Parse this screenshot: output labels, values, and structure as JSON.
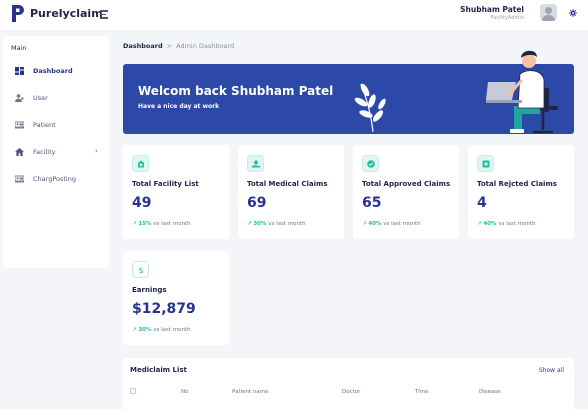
{
  "app": {
    "name": "Purelyclaim"
  },
  "user": {
    "name": "Shubham Patel",
    "role": "FacilityAdmin"
  },
  "sidebar": {
    "section": "Main",
    "items": [
      {
        "label": "Dashboard",
        "icon": "dashboard-icon",
        "active": true
      },
      {
        "label": "User",
        "icon": "user-icon"
      },
      {
        "label": "Patient",
        "icon": "patient-icon"
      },
      {
        "label": "Facility",
        "icon": "home-icon",
        "has_children": true
      },
      {
        "label": "ChargPosting",
        "icon": "charge-posting-icon"
      }
    ]
  },
  "breadcrumb": {
    "root": "Dashboard",
    "separator": ">",
    "current": "Admin Dashboard"
  },
  "banner": {
    "title": "Welcom back Shubham Patel",
    "subtitle": "Have a nice day at work"
  },
  "stats": [
    {
      "title": "Total Facility List",
      "value": "49",
      "delta": "15%",
      "delta_text": "vs last month",
      "icon": "hospital-icon"
    },
    {
      "title": "Total Medical Claims",
      "value": "69",
      "delta": "30%",
      "delta_text": "vs last month",
      "icon": "medical-hand-icon"
    },
    {
      "title": "Total Approved Claims",
      "value": "65",
      "delta": "40%",
      "delta_text": "vs last month",
      "icon": "check-circle-icon"
    },
    {
      "title": "Total Rejcted Claims",
      "value": "4",
      "delta": "40%",
      "delta_text": "vs last month",
      "icon": "rejected-box-icon"
    },
    {
      "title": "Earnings",
      "value": "$12,879",
      "delta": "30%",
      "delta_text": "vs last month",
      "icon": "dollar-icon"
    }
  ],
  "mediclaim": {
    "title": "Mediclaim List",
    "show_all": "Show all",
    "columns": [
      "No",
      "Patient name",
      "Doctor",
      "Time",
      "Disease"
    ]
  },
  "colors": {
    "primary": "#28338f",
    "banner": "#2c49a8",
    "accent": "#1fbf9e",
    "background": "#f4f5f9"
  }
}
